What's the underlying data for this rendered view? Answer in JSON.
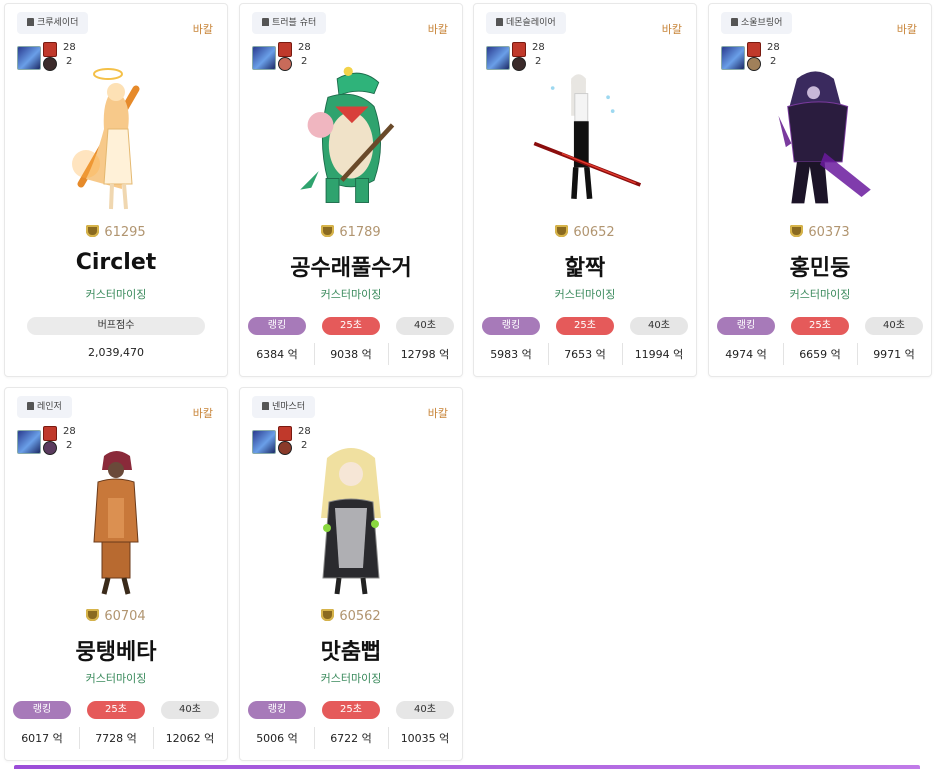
{
  "cards": [
    {
      "job": "크루세이더",
      "server": "바칼",
      "level": "28",
      "sub_count": "2",
      "fame": "61295",
      "name": "Circlet",
      "subtitle": "커스터마이징",
      "buff_label": "버프점수",
      "buff_value": "2,039,470",
      "sprite": "saint"
    },
    {
      "job": "트러블 슈터",
      "server": "바칼",
      "level": "28",
      "sub_count": "2",
      "fame": "61789",
      "name": "공수래풀수거",
      "subtitle": "커스터마이징",
      "stats": [
        {
          "label": "랭킹",
          "value": "6384 억"
        },
        {
          "label": "25초",
          "value": "9038 억"
        },
        {
          "label": "40초",
          "value": "12798 억"
        }
      ],
      "sprite": "croc"
    },
    {
      "job": "데몬슬레이어",
      "server": "바칼",
      "level": "28",
      "sub_count": "2",
      "fame": "60652",
      "name": "핥짝",
      "subtitle": "커스터마이징",
      "stats": [
        {
          "label": "랭킹",
          "value": "5983 억"
        },
        {
          "label": "25초",
          "value": "7653 억"
        },
        {
          "label": "40초",
          "value": "11994 억"
        }
      ],
      "sprite": "sword"
    },
    {
      "job": "소울브링어",
      "server": "바칼",
      "level": "28",
      "sub_count": "2",
      "fame": "60373",
      "name": "홍민둥",
      "subtitle": "커스터마이징",
      "stats": [
        {
          "label": "랭킹",
          "value": "4974 억"
        },
        {
          "label": "25초",
          "value": "6659 억"
        },
        {
          "label": "40초",
          "value": "9971 억"
        }
      ],
      "sprite": "dark"
    },
    {
      "job": "레인저",
      "server": "바칼",
      "level": "28",
      "sub_count": "2",
      "fame": "60704",
      "name": "뭉탱베타",
      "subtitle": "커스터마이징",
      "stats": [
        {
          "label": "랭킹",
          "value": "6017 억"
        },
        {
          "label": "25초",
          "value": "7728 억"
        },
        {
          "label": "40초",
          "value": "12062 억"
        }
      ],
      "sprite": "ranger"
    },
    {
      "job": "넨마스터",
      "server": "바칼",
      "level": "28",
      "sub_count": "2",
      "fame": "60562",
      "name": "맛춤뻡",
      "subtitle": "커스터마이징",
      "stats": [
        {
          "label": "랭킹",
          "value": "5006 억"
        },
        {
          "label": "25초",
          "value": "6722 억"
        },
        {
          "label": "40초",
          "value": "10035 억"
        }
      ],
      "sprite": "nen"
    }
  ]
}
